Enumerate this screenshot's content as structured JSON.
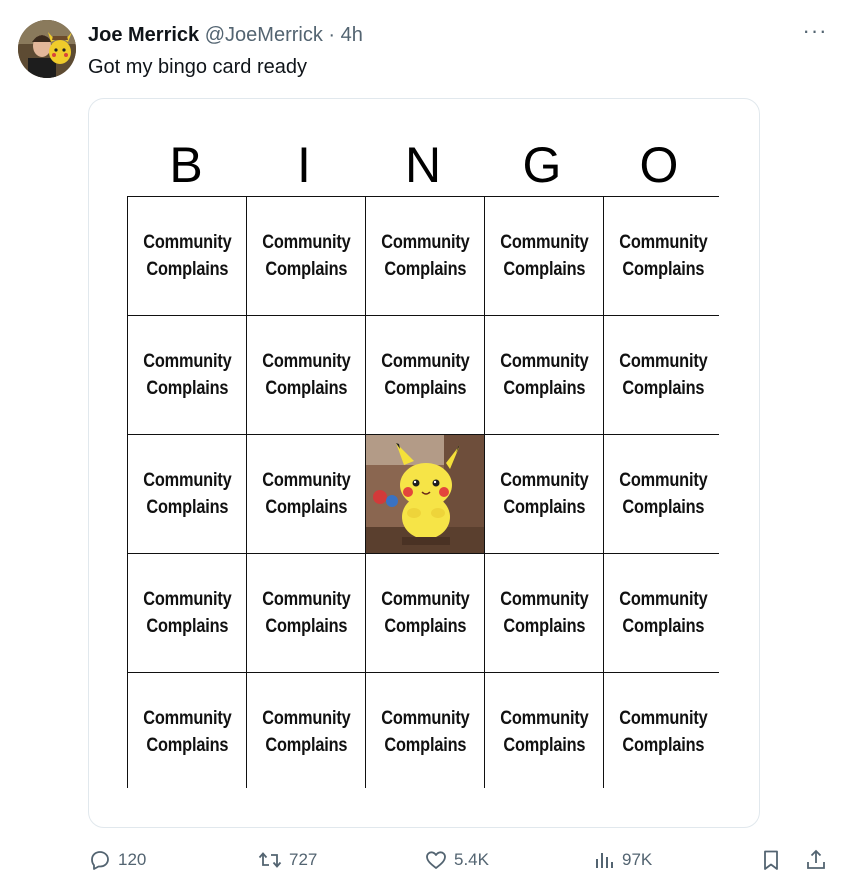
{
  "author": {
    "name": "Joe Merrick",
    "handle": "@JoeMerrick",
    "separator": "·",
    "time": "4h"
  },
  "more_label": "···",
  "tweet_text": "Got my bingo card ready",
  "bingo": {
    "letters": [
      "B",
      "I",
      "N",
      "G",
      "O"
    ],
    "cell_text": "Community\nComplains",
    "free_cell": "pikachu-plush-image"
  },
  "actions": {
    "replies": "120",
    "retweets": "727",
    "likes": "5.4K",
    "views": "97K"
  },
  "colors": {
    "text": "#0f1419",
    "secondary": "#536471",
    "border": "#e1e8ed"
  }
}
